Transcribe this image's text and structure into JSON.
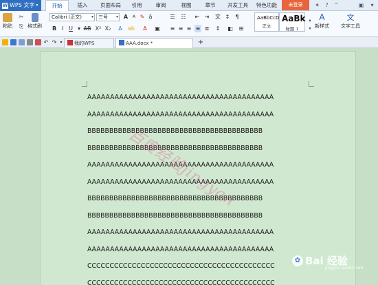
{
  "app": {
    "name": "WPS 文字",
    "logo_letter": "W"
  },
  "menu": {
    "tabs": [
      "开始",
      "插入",
      "页面布局",
      "引用",
      "审阅",
      "视图",
      "章节",
      "开发工具",
      "特色功能"
    ],
    "active": "开始",
    "login": "未登录"
  },
  "ribbon": {
    "paste": "粘贴",
    "format_painter": "格式刷",
    "font_name": "Calibri (正文)",
    "font_size": "三号",
    "style_normal_sample": "AaBbCcDd",
    "style_normal_name": "正文",
    "style_heading_sample": "AaBk",
    "style_heading_name": "标题 1",
    "new_style": "新样式",
    "text_tools": "文字工具"
  },
  "tabs": {
    "items": [
      {
        "label": "我的WPS"
      },
      {
        "label": "AAA.docx *"
      }
    ],
    "add": "+"
  },
  "document": {
    "lines": [
      "AAAAAAAAAAAAAAAAAAAAAAAAAAAAAAAAAAAAAAAAA",
      "AAAAAAAAAAAAAAAAAAAAAAAAAAAAAAAAAAAAAAAAA",
      "BBBBBBBBBBBBBBBBBBBBBBBBBBBBBBBBBBBBBBBB",
      "BBBBBBBBBBBBBBBBBBBBBBBBBBBBBBBBBBBBBBBB",
      "AAAAAAAAAAAAAAAAAAAAAAAAAAAAAAAAAAAAAAAAA",
      "AAAAAAAAAAAAAAAAAAAAAAAAAAAAAAAAAAAAAAAAA",
      "BBBBBBBBBBBBBBBBBBBBBBBBBBBBBBBBBBBBBBBB",
      "BBBBBBBBBBBBBBBBBBBBBBBBBBBBBBBBBBBBBBBB",
      "AAAAAAAAAAAAAAAAAAAAAAAAAAAAAAAAAAAAAAAAA",
      "AAAAAAAAAAAAAAAAAAAAAAAAAAAAAAAAAAAAAAAAA",
      "CCCCCCCCCCCCCCCCCCCCCCCCCCCCCCCCCCCCCCCCCC",
      "CCCCCCCCCCCCCCCCCCCCCCCCCCCCCCCCCCCCCCCCCC"
    ],
    "watermark": "百度经验jingyan"
  },
  "brand_watermark": {
    "text": "Bai 经验",
    "sub": "jingyan.baidu.com"
  },
  "colors": {
    "accent": "#2f6fc1",
    "login": "#e8643c",
    "page_bg": "#cfe8cf",
    "workspace_bg": "#c6dfc6",
    "watermark": "#e65a96"
  }
}
